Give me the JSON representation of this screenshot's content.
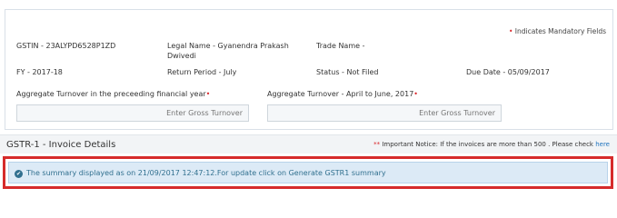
{
  "header": {
    "mandatory_star": "•",
    "mandatory_note": "Indicates Mandatory Fields"
  },
  "taxpayer": {
    "gstin": "GSTIN - 23ALYPD6528P1ZD",
    "legal_name_line1": "Legal Name - Gyanendra Prakash",
    "legal_name_line2": "Dwivedi",
    "trade_name": "Trade Name -",
    "fy": "FY - 2017-18",
    "return_period": "Return Period - July",
    "status": "Status - Not Filed",
    "due_date": "Due Date - 05/09/2017"
  },
  "turnover": {
    "prev_label": "Aggregate Turnover in the preceeding financial year",
    "prev_star": "•",
    "prev_placeholder": "Enter Gross Turnover",
    "current_label": "Aggregate Turnover - April to June, 2017",
    "current_star": "•",
    "current_placeholder": "Enter Gross Turnover"
  },
  "section": {
    "title": "GSTR-1 - Invoice Details",
    "notice_stars": "**",
    "notice_text": "Important Notice: If the invoices are more than 500 . Please check",
    "notice_link": "here"
  },
  "alert": {
    "icon": "check-circle-icon",
    "icon_glyph": "✔",
    "text": "The summary displayed as on 21/09/2017 12:47:12.For update click on Generate GSTR1 summary"
  },
  "colors": {
    "mandatory_star": "#d9262a",
    "alert_text": "#31708f",
    "alert_background": "#dceaf6",
    "highlight_border": "#d62b2b",
    "link": "#1e73be"
  }
}
